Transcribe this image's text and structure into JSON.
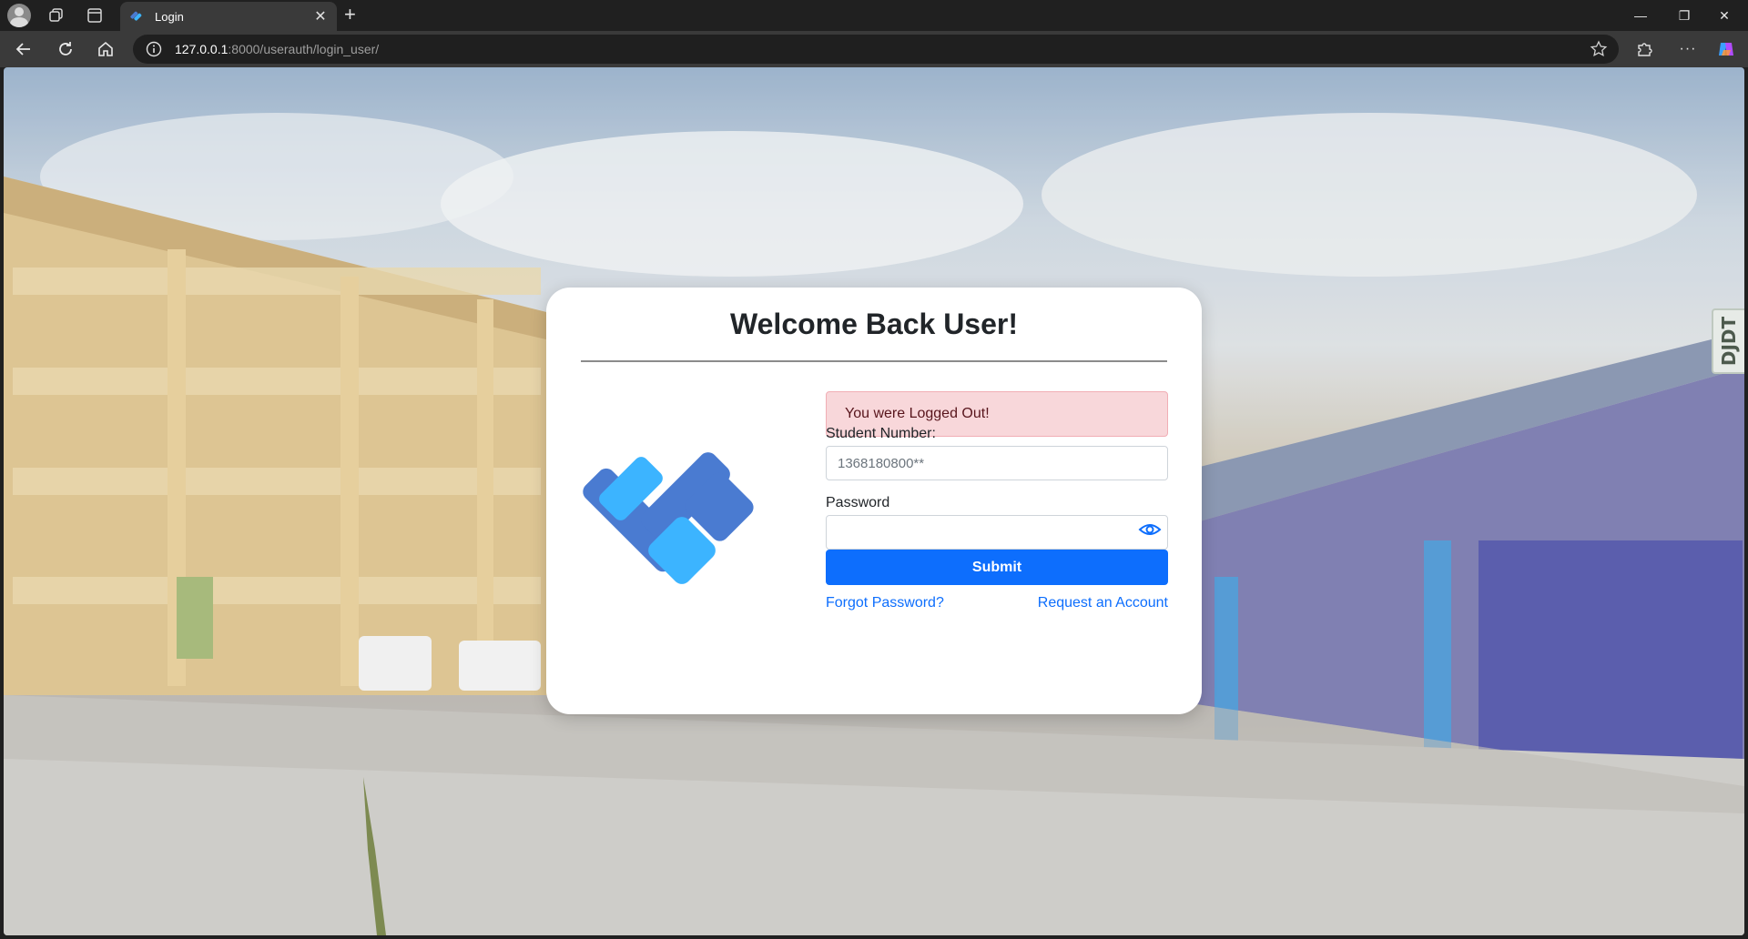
{
  "browser": {
    "tab_title": "Login",
    "url_host": "127.0.0.1",
    "url_path": ":8000/userauth/login_user/",
    "new_tab_label": "+",
    "tab_close_label": "✕",
    "window_controls": {
      "minimize": "—",
      "restore": "❐",
      "close": "✕"
    },
    "more_label": "···"
  },
  "login": {
    "title": "Welcome Back User!",
    "alert": "You were Logged Out!",
    "student_number_label": "Student Number:",
    "student_number_placeholder": "1368180800**",
    "password_label": "Password",
    "password_value": "",
    "submit_label": "Submit",
    "forgot_password_label": "Forgot Password?",
    "request_account_label": "Request an Account"
  },
  "side_tab_label": "DJDT",
  "colors": {
    "primary": "#0d6efd",
    "alert_bg": "#f8d7da",
    "logo_dark": "#4a7bd1",
    "logo_light": "#3cb4ff"
  },
  "icons": {
    "profile": "profile-icon",
    "workspaces": "workspaces-icon",
    "tab_actions": "tab-actions-icon",
    "back": "back-arrow-icon",
    "reload": "reload-icon",
    "home": "home-icon",
    "site_info": "info-icon",
    "favorite": "star-icon",
    "extensions": "puzzle-icon",
    "copilot": "copilot-icon",
    "password_toggle": "eye-icon"
  }
}
